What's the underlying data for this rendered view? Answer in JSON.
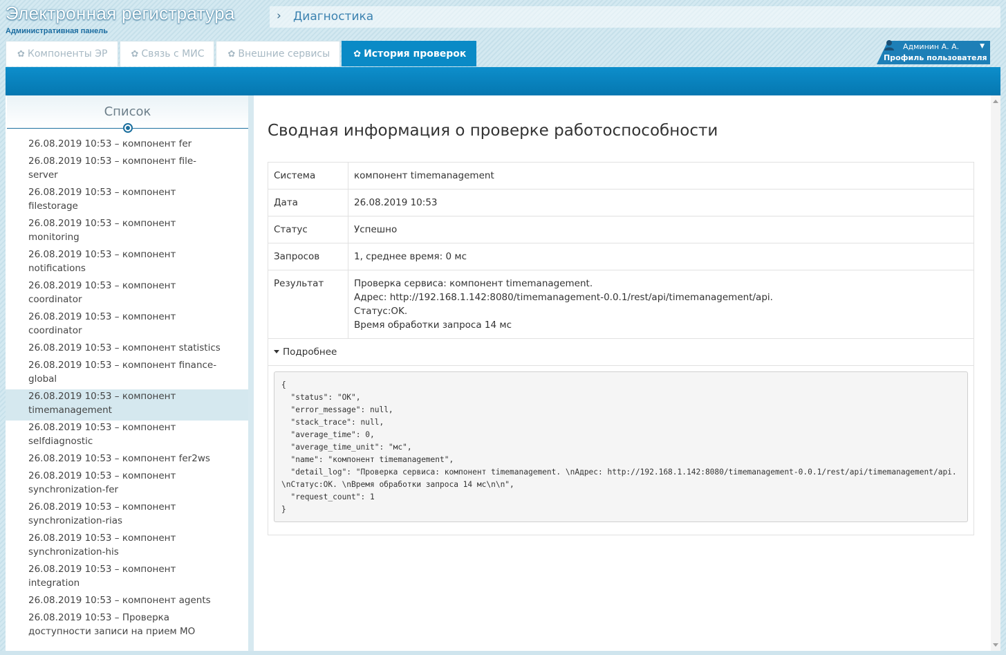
{
  "app": {
    "title": "Электронная регистратура",
    "subtitle": "Административная панель"
  },
  "breadcrumb": {
    "chevron": "›",
    "current": "Диагностика"
  },
  "tabs": [
    {
      "label": "Компоненты ЭР",
      "active": false
    },
    {
      "label": "Связь с МИС",
      "active": false
    },
    {
      "label": "Внешние сервисы",
      "active": false
    },
    {
      "label": "История проверок",
      "active": true
    }
  ],
  "profile": {
    "name": "Админин А. А.",
    "label": "Профиль пользователя",
    "icon": "user-icon"
  },
  "sidebar": {
    "title": "Список",
    "items": [
      "26.08.2019 10:53 – компонент fer",
      "26.08.2019 10:53 – компонент file-server",
      "26.08.2019 10:53 – компонент filestorage",
      "26.08.2019 10:53 – компонент monitoring",
      "26.08.2019 10:53 – компонент notifications",
      "26.08.2019 10:53 – компонент coordinator",
      "26.08.2019 10:53 – компонент coordinator",
      "26.08.2019 10:53 – компонент statistics",
      "26.08.2019 10:53 – компонент finance-global",
      "26.08.2019 10:53 – компонент timemanagement",
      "26.08.2019 10:53 – компонент selfdiagnostic",
      "26.08.2019 10:53 – компонент fer2ws",
      "26.08.2019 10:53 – компонент synchronization-fer",
      "26.08.2019 10:53 – компонент synchronization-rias",
      "26.08.2019 10:53 – компонент synchronization-his",
      "26.08.2019 10:53 – компонент integration",
      "26.08.2019 10:53 – компонент agents",
      "26.08.2019 10:53 – Проверка доступности записи на прием МО"
    ],
    "active_index": 9
  },
  "content": {
    "title": "Сводная информация о проверке работоспособности",
    "rows": [
      {
        "key": "Система",
        "value": "компонент timemanagement"
      },
      {
        "key": "Дата",
        "value": "26.08.2019 10:53"
      },
      {
        "key": "Статус",
        "value": "Успешно"
      },
      {
        "key": "Запросов",
        "value": "1, среднее время: 0 мс"
      }
    ],
    "result_key": "Результат",
    "result_lines": [
      "Проверка сервиса: компонент timemanagement.",
      "Адрес: http://192.168.1.142:8080/timemanagement-0.0.1/rest/api/timemanagement/api.",
      "Статус:OK.",
      "Время обработки запроса 14 мс"
    ],
    "details_label": "Подробнее",
    "json_text": "{\n  \"status\": \"OK\",\n  \"error_message\": null,\n  \"stack_trace\": null,\n  \"average_time\": 0,\n  \"average_time_unit\": \"мс\",\n  \"name\": \"компонент timemanagement\",\n  \"detail_log\": \"Проверка сервиса: компонент timemanagement. \\nАдрес: http://192.168.1.142:8080/timemanagement-0.0.1/rest/api/timemanagement/api. \\nСтатус:OK. \\nВремя обработки запроса 14 мс\\n\\n\",\n  \"request_count\": 1\n}"
  },
  "colors": {
    "accent": "#0a8ac6",
    "active_item_bg": "#d5e8ef",
    "title_link": "#3b82b0"
  }
}
